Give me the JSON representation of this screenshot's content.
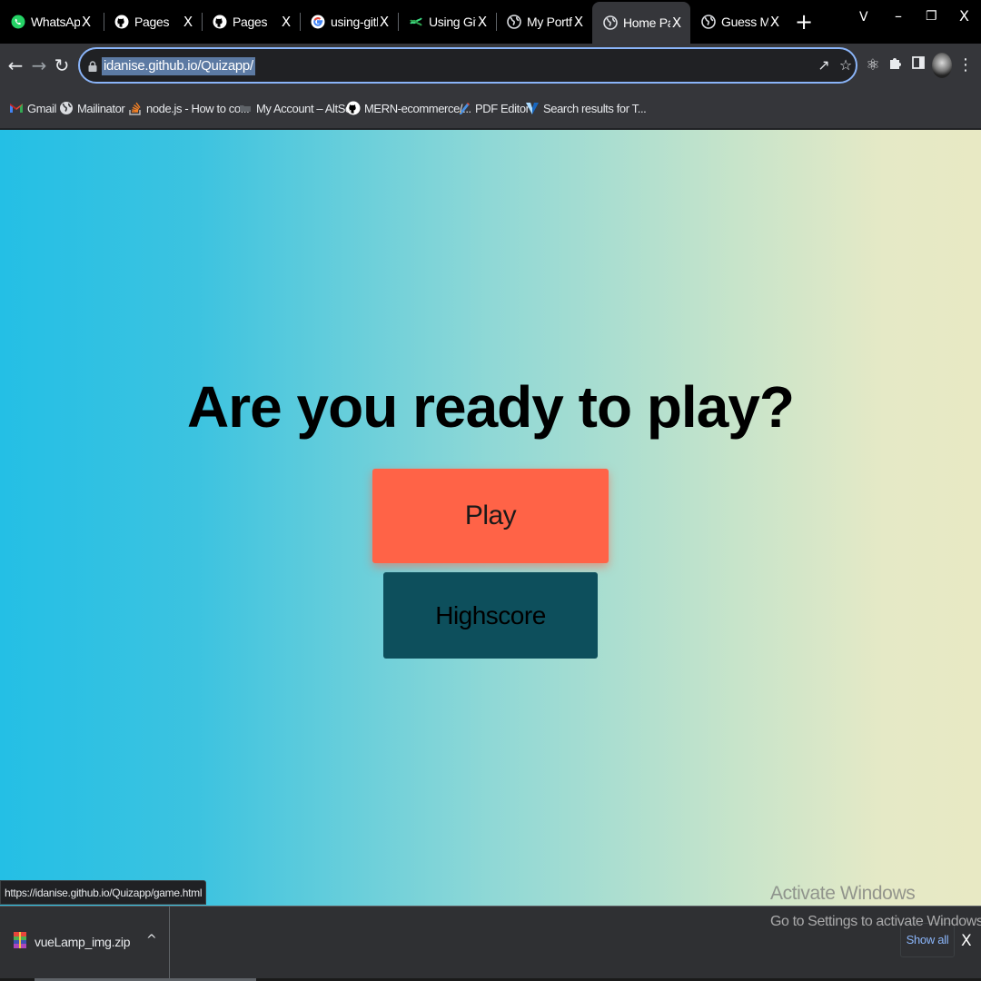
{
  "browser": {
    "tabs": [
      {
        "title": "WhatsApp W",
        "icon": "whatsapp-icon",
        "active": false
      },
      {
        "title": "Pages",
        "icon": "github-icon",
        "active": false
      },
      {
        "title": "Pages",
        "icon": "github-icon",
        "active": false
      },
      {
        "title": "using-github",
        "icon": "google-icon",
        "active": false
      },
      {
        "title": "Using GitHub",
        "icon": "gitbook-icon",
        "active": false
      },
      {
        "title": "My Portfolio",
        "icon": "globe-icon",
        "active": false
      },
      {
        "title": "Home Page",
        "icon": "globe-icon",
        "active": true
      },
      {
        "title": "Guess My Nu",
        "icon": "globe-icon",
        "active": false
      }
    ],
    "tab_close_glyph": "X",
    "new_tab_glyph": "+",
    "window_controls": {
      "tab_search": "V",
      "minimize": "–",
      "restore": "❐",
      "close": "X"
    },
    "address_bar": {
      "url": "idanise.github.io/Quizapp/"
    },
    "bookmarks": [
      {
        "label": "Gmail",
        "icon": "gmail-icon"
      },
      {
        "label": "Mailinator",
        "icon": "globe-icon"
      },
      {
        "label": "node.js - How to co...",
        "icon": "stackoverflow-icon"
      },
      {
        "label": "My Account – AltSc...",
        "icon": "folder-icon"
      },
      {
        "label": "MERN-ecommerce/...",
        "icon": "github-icon"
      },
      {
        "label": "PDF Editor",
        "icon": "pdf-editor-icon"
      },
      {
        "label": "Search results for T...",
        "icon": "vuetify-icon"
      }
    ],
    "status_bar_url": "https://idanise.github.io/Quizapp/game.html"
  },
  "page": {
    "headline": "Are you ready to play?",
    "play_label": "Play",
    "highscore_label": "Highscore",
    "colors": {
      "play": "#ff6347",
      "highscore": "#0d4f5c",
      "gradient_start": "#24bfe5",
      "gradient_end": "#e8e9c4"
    }
  },
  "windows_watermark": {
    "title": "Activate Windows",
    "subtitle": "Go to Settings to activate Windows."
  },
  "download_shelf": {
    "file_name": "vueLamp_img.zip",
    "caret": "^",
    "show_all_label": "Show all",
    "close_glyph": "X"
  }
}
